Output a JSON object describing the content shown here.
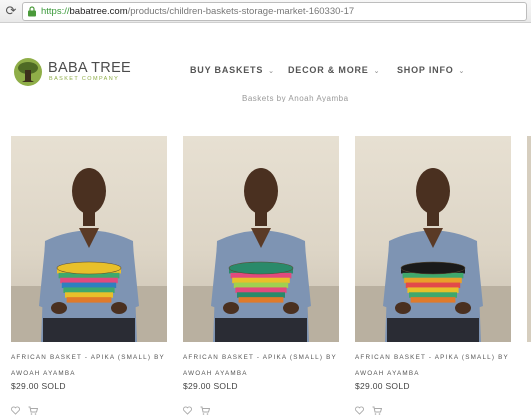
{
  "browser": {
    "url_scheme": "https://",
    "url_host": "babatree.com",
    "url_path": "/products/children-baskets-storage-market-160330-17",
    "reload_icon": "reload-icon",
    "lock_icon": "lock-icon"
  },
  "header": {
    "logo_name": "BABA TREE",
    "logo_sub": "BASKET COMPANY",
    "logo_icon": "baobab-tree-icon",
    "nav": [
      {
        "label": "BUY BASKETS",
        "caret": "⌄"
      },
      {
        "label": "DECOR & MORE",
        "caret": "⌄"
      },
      {
        "label": "SHOP INFO",
        "caret": "⌄"
      }
    ],
    "cut_text": "Baskets by Anoah Ayamba"
  },
  "products": [
    {
      "title": "AFRICAN BASKET - APIKA (SMALL) BY AWOAH AYAMBA",
      "price": "$29.00 SOLD",
      "basket_colors": [
        "#e8c02a",
        "#3fa86c",
        "#e24a7d",
        "#2f7fc0",
        "#3fa86c",
        "#e8c02a",
        "#e07a2a"
      ],
      "icons": [
        "heart-icon",
        "cart-icon"
      ]
    },
    {
      "title": "AFRICAN BASKET - APIKA (SMALL) BY AWOAH AYAMBA",
      "price": "$29.00 SOLD",
      "basket_colors": [
        "#2a8a6a",
        "#e24a7d",
        "#e8c02a",
        "#a0d050",
        "#e24a7d",
        "#2a8a6a",
        "#e07a2a"
      ],
      "icons": [
        "heart-icon",
        "cart-icon"
      ]
    },
    {
      "title": "AFRICAN BASKET - APIKA (SMALL) BY AWOAH AYAMBA",
      "price": "$29.00 SOLD",
      "basket_colors": [
        "#1a1a1a",
        "#3fa86c",
        "#e8a02a",
        "#e24a4a",
        "#e8c02a",
        "#3fa86c",
        "#e07a2a"
      ],
      "icons": [
        "heart-icon",
        "cart-icon"
      ]
    }
  ],
  "colors": {
    "accent_green": "#8fae48",
    "secure_green": "#3a9a3a",
    "text_dark": "#4c4c4c"
  }
}
